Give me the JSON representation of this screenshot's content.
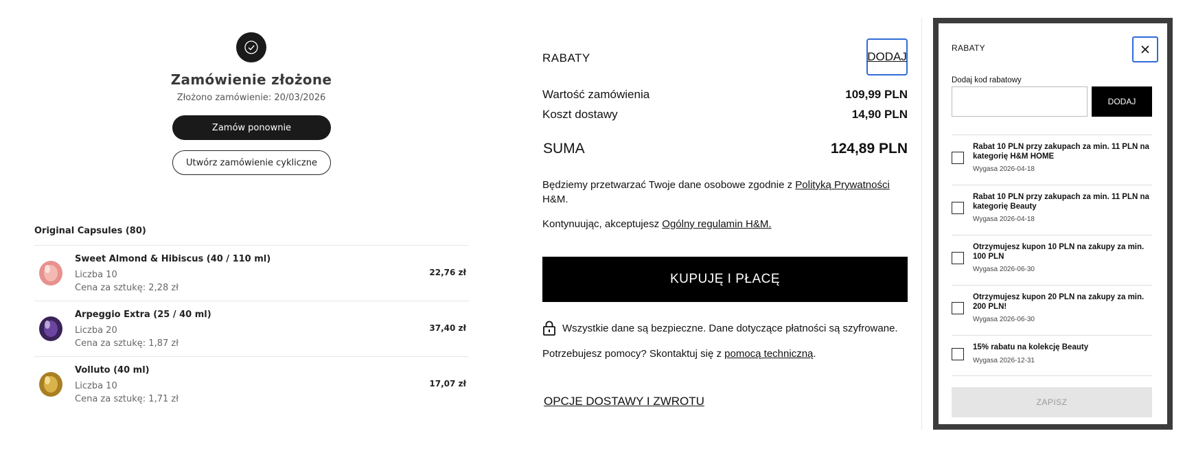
{
  "order": {
    "title": "Zamówienie złożone",
    "date_line": "Złożono zamówienie: 20/03/2026",
    "reorder_label": "Zamów ponownie",
    "cyclic_label": "Utwórz zamówienie cykliczne"
  },
  "capsules": {
    "heading": "Original Capsules (80)",
    "items": [
      {
        "name": "Sweet Almond & Hibiscus (40 / 110 ml)",
        "qty": "Liczba 10",
        "unit": "Cena za sztukę: 2,28 zł",
        "price": "22,76 zł",
        "color": "#e8918e"
      },
      {
        "name": "Arpeggio Extra (25 / 40 ml)",
        "qty": "Liczba 20",
        "unit": "Cena za sztukę: 1,87 zł",
        "price": "37,40 zł",
        "color": "#4a2c6e"
      },
      {
        "name": "Volluto (40 ml)",
        "qty": "Liczba 10",
        "unit": "Cena za sztukę: 1,71 zł",
        "price": "17,07 zł",
        "color": "#c9a23a"
      }
    ]
  },
  "summary": {
    "rabaty_label": "RABATY",
    "dodaj_label": "DODAJ",
    "order_value_label": "Wartość zamówienia",
    "order_value": "109,99 PLN",
    "shipping_label": "Koszt dostawy",
    "shipping_value": "14,90 PLN",
    "total_label": "SUMA",
    "total_value": "124,89 PLN",
    "privacy_prefix": "Będziemy przetwarzać Twoje dane osobowe zgodnie z ",
    "privacy_link": "Polityką Prywatności",
    "privacy_suffix": "H&M.",
    "terms_prefix": "Kontynuując, akceptujesz ",
    "terms_link": "Ogólny regulamin H&M.",
    "buy_label": "KUPUJĘ I PŁACĘ",
    "secure_text": "Wszystkie dane są bezpieczne. Dane dotyczące płatności są szyfrowane.",
    "help_prefix": "Potrzebujesz pomocy? Skontaktuj się z ",
    "help_link": "pomocą techniczną",
    "help_suffix": ".",
    "delivery_link": "OPCJE DOSTAWY I ZWROTU"
  },
  "modal": {
    "title": "RABATY",
    "code_label": "Dodaj kod rabatowy",
    "code_value": "",
    "add_label": "DODAJ",
    "save_label": "ZAPISZ",
    "coupons": [
      {
        "text": "Rabat 10 PLN przy zakupach za min. 11 PLN na kategorię H&M HOME",
        "expiry": "Wygasa 2026-04-18"
      },
      {
        "text": "Rabat 10 PLN przy zakupach za min. 11 PLN na kategorię Beauty",
        "expiry": "Wygasa 2026-04-18"
      },
      {
        "text": "Otrzymujesz kupon 10 PLN na zakupy za min. 100 PLN",
        "expiry": "Wygasa 2026-06-30"
      },
      {
        "text": "Otrzymujesz kupon 20 PLN na zakupy za min. 200 PLN!",
        "expiry": "Wygasa 2026-06-30"
      },
      {
        "text": "15% rabatu na kolekcję Beauty",
        "expiry": "Wygasa 2026-12-31"
      }
    ]
  },
  "colors": {
    "accent_focus": "#2f6bd8",
    "modal_frame": "#3c3c3c"
  }
}
